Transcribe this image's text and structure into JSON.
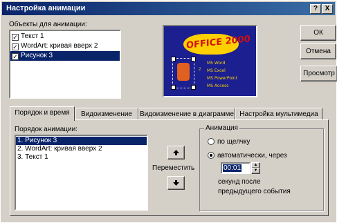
{
  "window": {
    "title": "Настройка анимации",
    "help_label": "?",
    "close_label": "X"
  },
  "objects": {
    "label": "Объекты для анимации:",
    "items": [
      {
        "label": "Текст 1",
        "checked": true
      },
      {
        "label": "WordArt: кривая вверх 2",
        "checked": true
      },
      {
        "label": "Рисунок 3",
        "checked": true
      }
    ]
  },
  "buttons": {
    "ok": "ОК",
    "cancel": "Отмена",
    "preview": "Просмотр"
  },
  "preview_slide": {
    "title": "OFFICE 2000",
    "items": [
      "MS Word",
      "MS Excel",
      "MS PowerPoint",
      "MS Access"
    ],
    "number": "2"
  },
  "tabs": [
    "Порядок и время",
    "Видоизменение",
    "Видоизменение в диаграмме",
    "Настройка мультимедиа"
  ],
  "order": {
    "label": "Порядок анимации:",
    "items": [
      "1. Рисунок 3",
      "2. WordArt: кривая вверх 2",
      "3. Текст 1"
    ],
    "move_label": "Переместить"
  },
  "animation": {
    "legend": "Анимация",
    "on_click": "по щелчку",
    "auto": "автоматически, через",
    "time_value": "00:01",
    "seconds_line1": "секунд после",
    "seconds_line2": "предыдущего события"
  }
}
